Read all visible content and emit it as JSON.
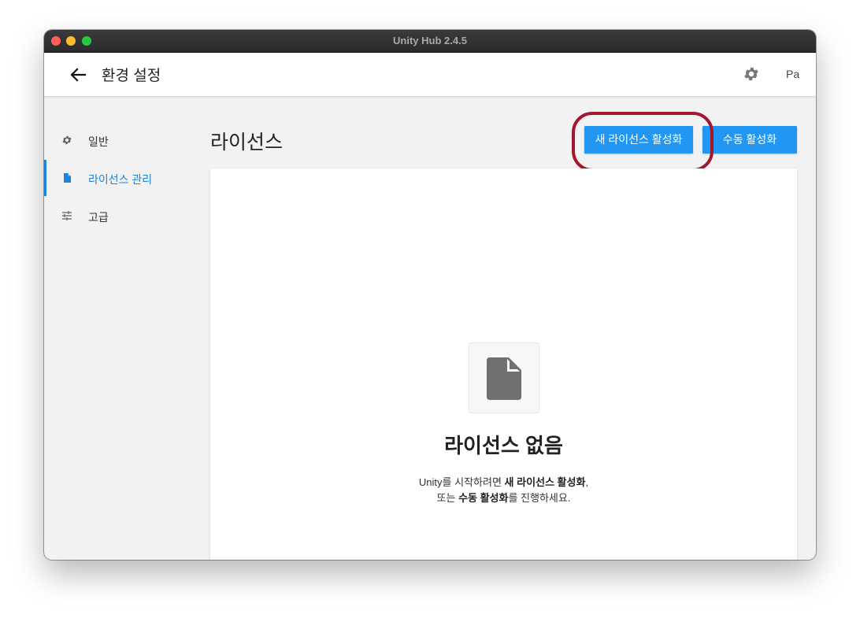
{
  "window": {
    "title": "Unity Hub 2.4.5"
  },
  "header": {
    "title": "환경 설정",
    "avatar_text": "Pa"
  },
  "sidebar": {
    "items": [
      {
        "label": "일반",
        "icon": "gear-icon",
        "active": false
      },
      {
        "label": "라이선스 관리",
        "icon": "document-icon",
        "active": true
      },
      {
        "label": "고급",
        "icon": "sliders-icon",
        "active": false
      }
    ]
  },
  "main": {
    "title": "라이선스",
    "buttons": {
      "new_license": "새 라이선스 활성화",
      "manual": "수동 활성화"
    },
    "empty": {
      "title": "라이선스 없음",
      "line1": {
        "pre": "Unity를 시작하려면 ",
        "bold": "새 라이선스 활성화",
        "post": ","
      },
      "line2": {
        "pre": "또는 ",
        "bold": "수동 활성화",
        "post": "를 진행하세요."
      }
    }
  },
  "colors": {
    "accent": "#2196f3",
    "active_text": "#1f84d9",
    "highlight_ring": "#a6162f"
  }
}
